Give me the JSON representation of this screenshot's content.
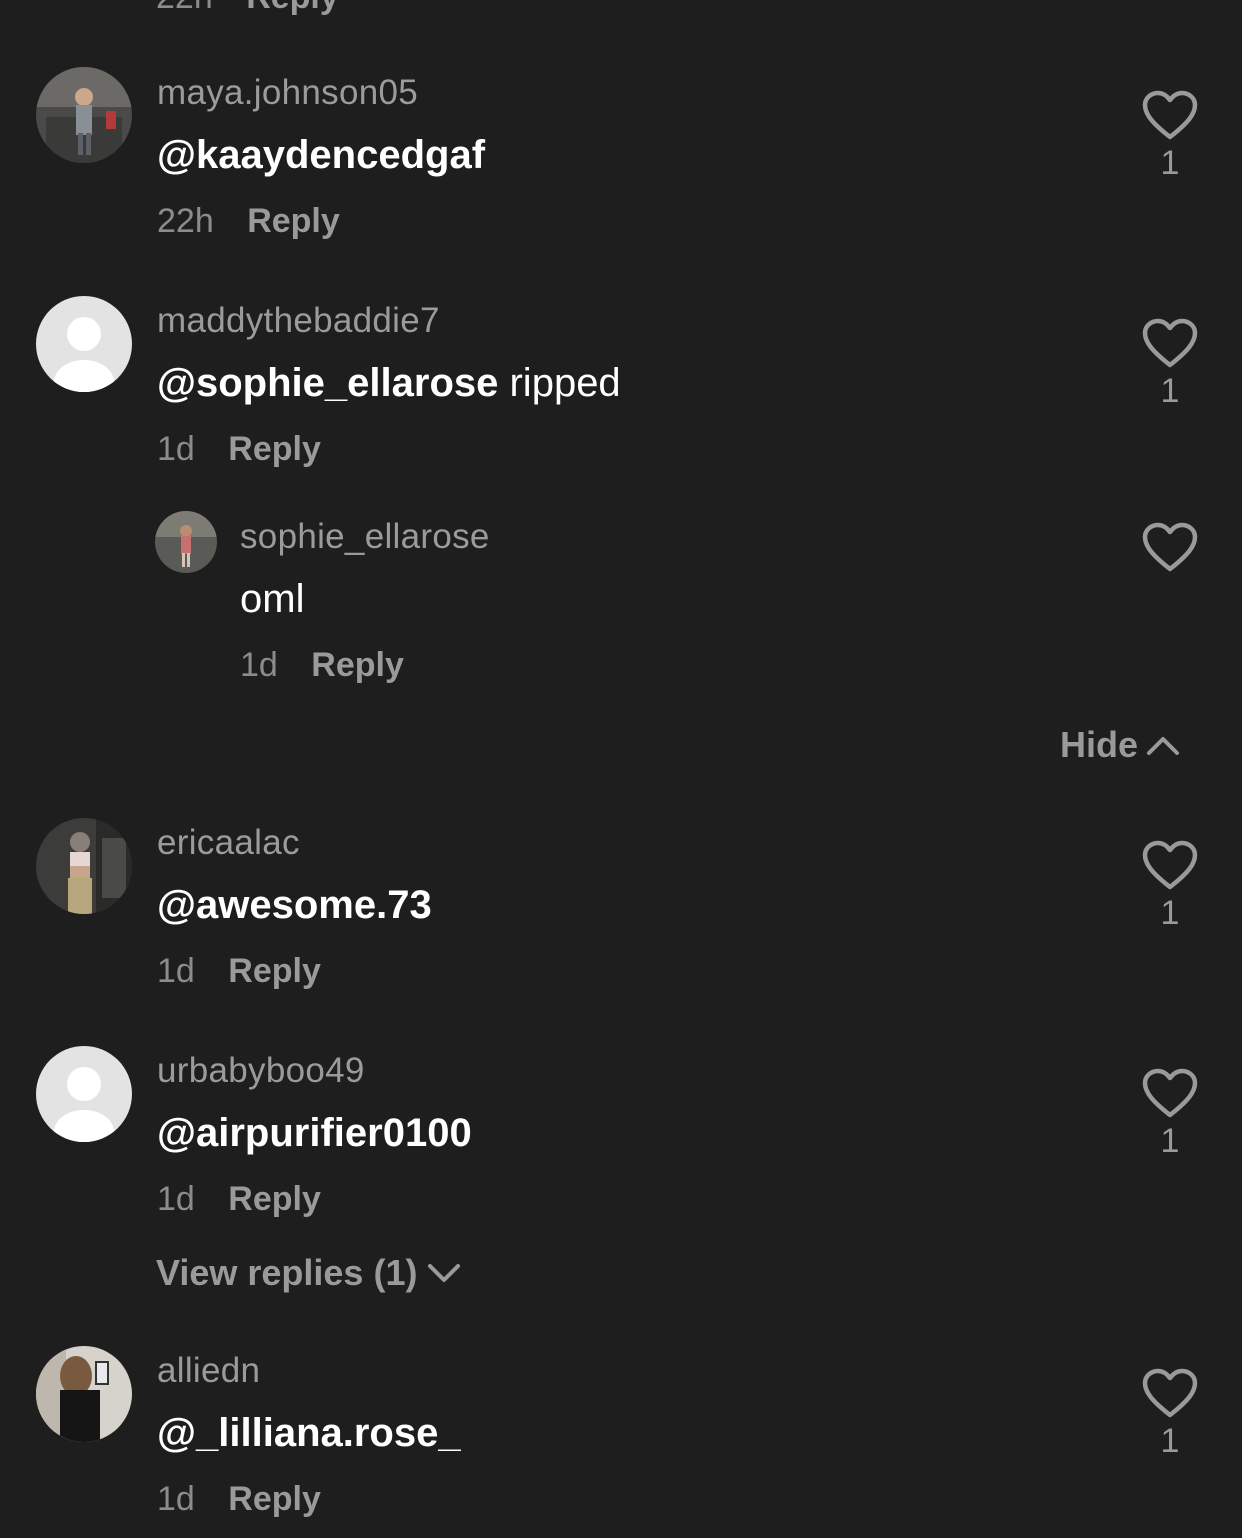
{
  "top_partial": {
    "time": "22h",
    "reply_label": "Reply"
  },
  "comments": [
    {
      "username": "maya.johnson05",
      "mention": "@kaaydencedgaf",
      "text": "",
      "time": "22h",
      "reply_label": "Reply",
      "likes": "1",
      "avatar": "photo"
    },
    {
      "username": "maddythebaddie7",
      "mention": "@sophie_ellarose",
      "text": " ripped",
      "time": "1d",
      "reply_label": "Reply",
      "likes": "1",
      "avatar": "default-avatar-icon",
      "replies": [
        {
          "username": "sophie_ellarose",
          "mention": "",
          "text": "oml",
          "time": "1d",
          "reply_label": "Reply",
          "likes": "",
          "avatar": "photo"
        }
      ],
      "hide_label": "Hide"
    },
    {
      "username": "ericaalac",
      "mention": "@awesome.73",
      "text": "",
      "time": "1d",
      "reply_label": "Reply",
      "likes": "1",
      "avatar": "photo"
    },
    {
      "username": "urbabyboo49",
      "mention": "@airpurifier0100",
      "text": "",
      "time": "1d",
      "reply_label": "Reply",
      "likes": "1",
      "avatar": "default-avatar-icon",
      "view_replies_label": "View replies (1)"
    },
    {
      "username": "alliedn",
      "mention": "@_lilliana.rose_",
      "text": "",
      "time": "1d",
      "reply_label": "Reply",
      "likes": "1",
      "avatar": "photo"
    }
  ],
  "icons": {
    "like": "heart-outline-icon",
    "hide": "chevron-up-icon",
    "view_replies": "chevron-down-icon"
  },
  "colors": {
    "background": "#1e1e1e",
    "username": "#9b9b9b",
    "text": "#ffffff",
    "meta": "#8c8c8c"
  }
}
